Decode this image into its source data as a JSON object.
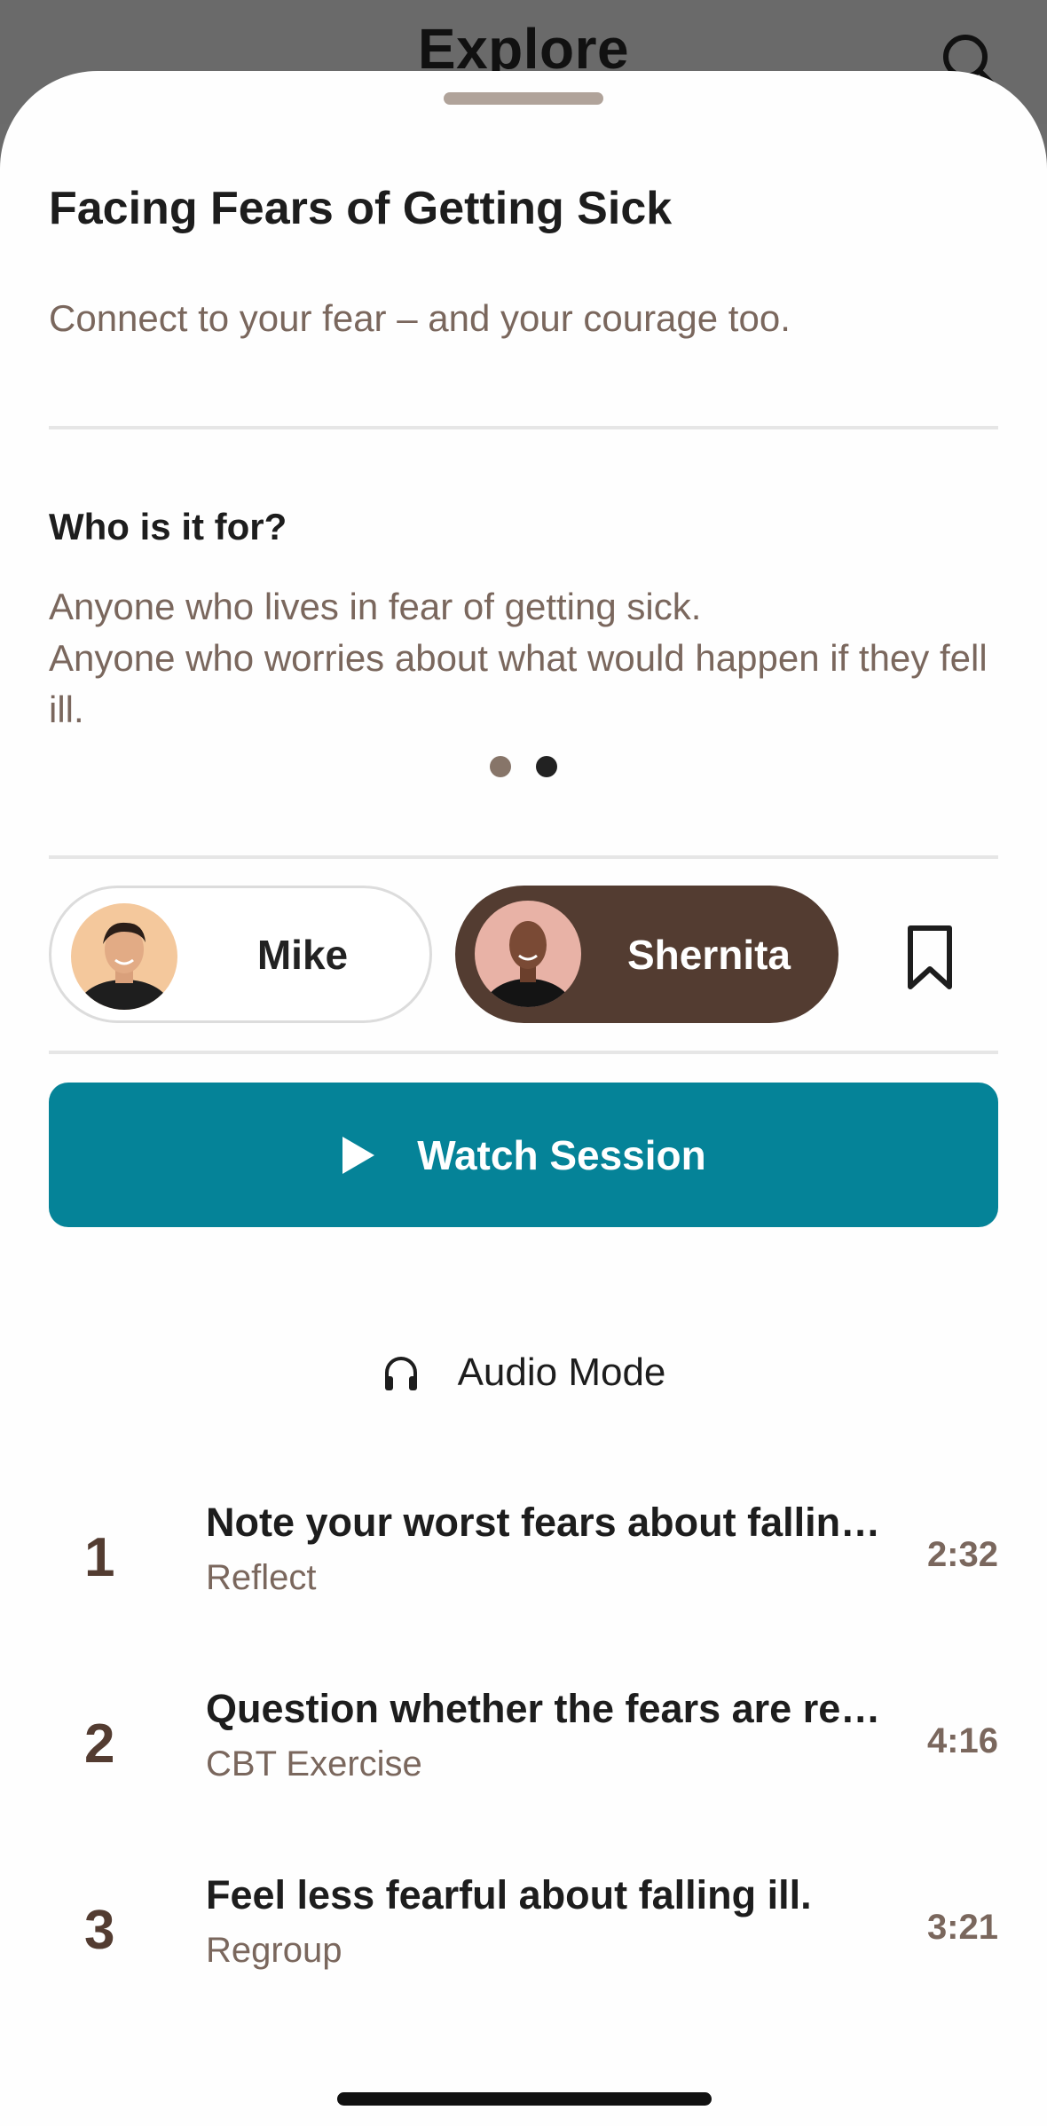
{
  "background": {
    "title": "Explore"
  },
  "session": {
    "title": "Facing Fears of Getting Sick",
    "subtitle": "Connect to your fear – and your courage too.",
    "who_heading": "Who is it for?",
    "who_text": "Anyone who lives in fear of getting sick.\nAnyone who worries about what would happen if they fell ill."
  },
  "pager": {
    "page_count": 2,
    "active_page": 2
  },
  "coaches": [
    {
      "name": "Mike",
      "selected": false
    },
    {
      "name": "Shernita",
      "selected": true
    }
  ],
  "actions": {
    "watch_label": "Watch Session",
    "audio_label": "Audio Mode"
  },
  "steps": [
    {
      "number": "1",
      "title": "Note your worst fears about falling ill.",
      "subtitle": "Reflect",
      "duration": "2:32"
    },
    {
      "number": "2",
      "title": "Question whether the fears are realistic.",
      "subtitle": "CBT Exercise",
      "duration": "4:16"
    },
    {
      "number": "3",
      "title": "Feel less fearful about falling ill.",
      "subtitle": "Regroup",
      "duration": "3:21"
    }
  ],
  "colors": {
    "accent": "#058398",
    "brown": "#533c31",
    "muted_text": "#7a675d"
  }
}
